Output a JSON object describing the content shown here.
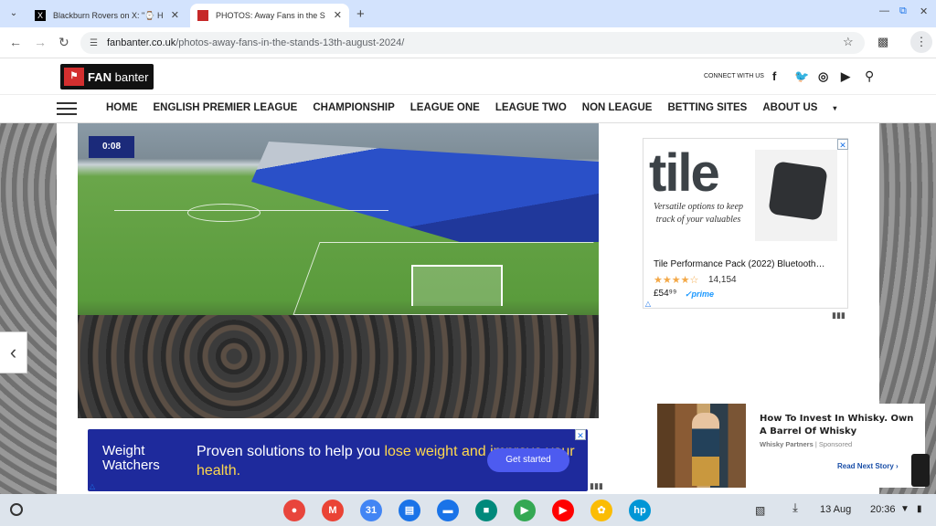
{
  "browser": {
    "tabs": [
      {
        "title": "Blackburn Rovers on X: \"⌚ Ha",
        "active": false
      },
      {
        "title": "PHOTOS: Away Fans in the Sta",
        "active": true
      }
    ],
    "new_tab": "+",
    "url_domain": "fanbanter.co.uk",
    "url_path": "/photos-away-fans-in-the-stands-13th-august-2024/"
  },
  "site": {
    "logo_text_bold": "FAN",
    "logo_text": " banter",
    "connect_label": "CONNECT WITH US",
    "social": [
      "f",
      "🐦",
      "◎",
      "▶"
    ],
    "nav": [
      "HOME",
      "ENGLISH PREMIER LEAGUE",
      "CHAMPIONSHIP",
      "LEAGUE ONE",
      "LEAGUE TWO",
      "NON LEAGUE",
      "BETTING SITES",
      "ABOUT US"
    ],
    "about_caret": "▾"
  },
  "ww_ad": {
    "brand_line1": "Weight",
    "brand_line2": "Watchers",
    "text_before": "Proven solutions to help you ",
    "text_highlight": "lose weight and improve your health.",
    "cta": "Get started"
  },
  "tile_ad": {
    "logo": "tile",
    "tagline": "Versatile options to keep track of your valuables",
    "product": "Tile Performance Pack (2022) Bluetooth…",
    "stars": "★★★★☆",
    "reviews": "14,154",
    "price": "£54⁹⁹",
    "prime": "✓prime"
  },
  "reco": {
    "title": "How To Invest In Whisky. Own A Barrel Of Whisky",
    "source": "Whisky Partners",
    "sponsored": "Sponsored",
    "more": "Read Next Story ›"
  },
  "shelf": {
    "date": "13 Aug",
    "time": "20:36",
    "apps": [
      {
        "name": "chrome",
        "color": "#e8453c"
      },
      {
        "name": "gmail",
        "color": "#ea4335"
      },
      {
        "name": "calendar",
        "color": "#4285f4"
      },
      {
        "name": "files",
        "color": "#1a73e8"
      },
      {
        "name": "messages",
        "color": "#1a73e8"
      },
      {
        "name": "meet",
        "color": "#00897b"
      },
      {
        "name": "play-store",
        "color": "#34a853"
      },
      {
        "name": "youtube",
        "color": "#ff0000"
      },
      {
        "name": "photos",
        "color": "#fbbc04"
      },
      {
        "name": "hp",
        "color": "#0096d6"
      }
    ]
  }
}
